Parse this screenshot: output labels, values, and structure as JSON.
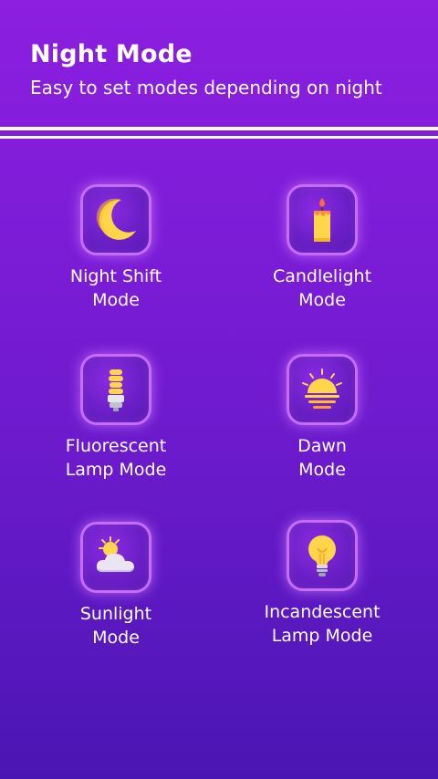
{
  "header": {
    "title": "Night Mode",
    "subtitle": "Easy to set modes depending on night"
  },
  "modes": [
    {
      "line1": "Night Shift",
      "line2": "Mode",
      "icon": "moon-icon"
    },
    {
      "line1": "Candlelight",
      "line2": "Mode",
      "icon": "candle-icon"
    },
    {
      "line1": "Fluorescent",
      "line2": "Lamp Mode",
      "icon": "fluorescent-bulb-icon"
    },
    {
      "line1": "Dawn",
      "line2": "Mode",
      "icon": "sunrise-icon"
    },
    {
      "line1": "Sunlight",
      "line2": "Mode",
      "icon": "sun-cloud-icon"
    },
    {
      "line1": "Incandescent",
      "line2": "Lamp Mode",
      "icon": "light-bulb-icon"
    }
  ],
  "colors": {
    "background_top": "#8c1fe0",
    "background_bottom": "#4a16b3",
    "tile_border": "#c86bff",
    "icon_yellow": "#ffd54a"
  }
}
